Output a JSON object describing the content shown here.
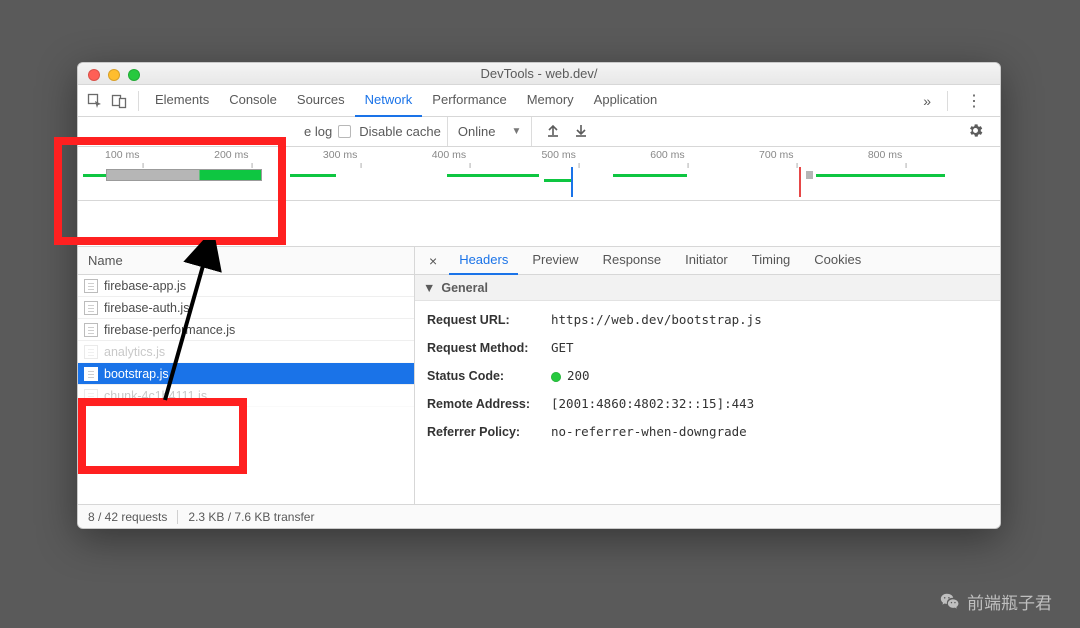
{
  "window": {
    "title": "DevTools - web.dev/"
  },
  "tabs": [
    "Elements",
    "Console",
    "Sources",
    "Network",
    "Performance",
    "Memory",
    "Application"
  ],
  "active_tab_index": 3,
  "toolbar": {
    "preserve_log_suffix": "e log",
    "disable_cache": "Disable cache",
    "throttling": "Online",
    "upload_icon": "▲",
    "download_icon": "▼"
  },
  "overview_ticks": [
    "100 ms",
    "200 ms",
    "300 ms",
    "400 ms",
    "500 ms",
    "600 ms",
    "700 ms",
    "800 ms"
  ],
  "name_col": "Name",
  "requests": [
    {
      "name": "firebase-app.js",
      "selected": false
    },
    {
      "name": "firebase-auth.js",
      "selected": false
    },
    {
      "name": "firebase-performance.js",
      "selected": false
    },
    {
      "name": "analytics.js",
      "selected": false,
      "faded": true
    },
    {
      "name": "bootstrap.js",
      "selected": true
    },
    {
      "name": "chunk-4c1b4111.js",
      "selected": false,
      "faded": true
    }
  ],
  "status_bar": {
    "requests": "8 / 42 requests",
    "transfer": "2.3 KB / 7.6 KB transfer"
  },
  "detail_tabs": [
    "Headers",
    "Preview",
    "Response",
    "Initiator",
    "Timing",
    "Cookies"
  ],
  "detail_active_index": 0,
  "section_title": "General",
  "general": {
    "request_url": {
      "k": "Request URL:",
      "v": "https://web.dev/bootstrap.js"
    },
    "request_method": {
      "k": "Request Method:",
      "v": "GET"
    },
    "status_code": {
      "k": "Status Code:",
      "v": "200"
    },
    "remote_addr": {
      "k": "Remote Address:",
      "v": "[2001:4860:4802:32::15]:443"
    },
    "referrer_policy": {
      "k": "Referrer Policy:",
      "v": "no-referrer-when-downgrade"
    }
  },
  "watermark": "前端瓶子君"
}
